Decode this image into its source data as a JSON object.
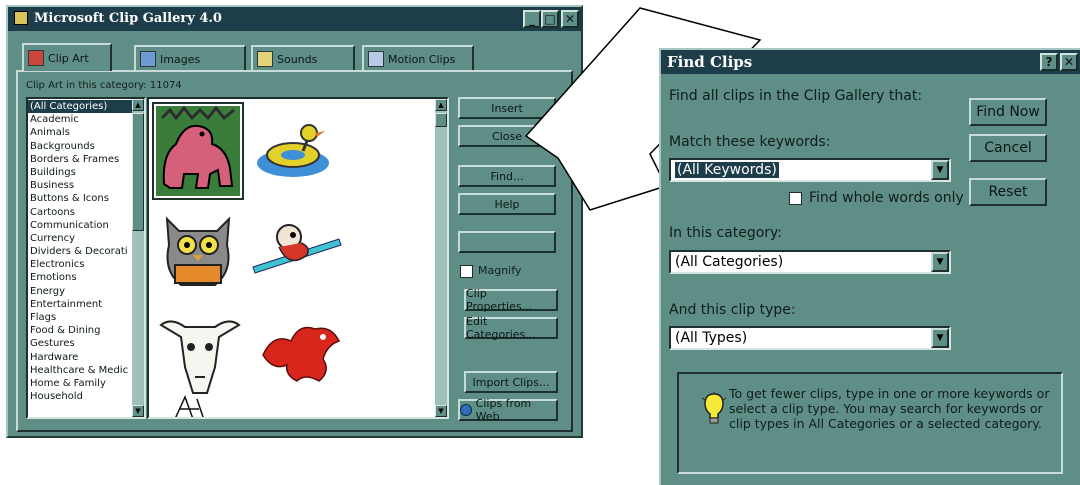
{
  "clip_gallery": {
    "title": "Microsoft Clip Gallery 4.0",
    "window_controls": [
      "_",
      "□",
      "✕"
    ],
    "tabs": [
      {
        "label": "Clip Art"
      },
      {
        "label": "Images"
      },
      {
        "label": "Sounds"
      },
      {
        "label": "Motion Clips"
      }
    ],
    "category_caption": "Clip Art in this category: 11074",
    "categories": [
      "(All Categories)",
      "Academic",
      "Animals",
      "Backgrounds",
      "Borders & Frames",
      "Buildings",
      "Business",
      "Buttons & Icons",
      "Cartoons",
      "Communication",
      "Currency",
      "Dividers & Decorati",
      "Electronics",
      "Emotions",
      "Energy",
      "Entertainment",
      "Flags",
      "Food & Dining",
      "Gestures",
      "Hardware",
      "Healthcare & Medic",
      "Home & Family",
      "Household"
    ],
    "buttons": {
      "insert": "Insert",
      "close": "Close",
      "find": "Find...",
      "help": "Help",
      "blank": "",
      "clip_properties": "Clip Properties...",
      "edit_categories": "Edit Categories...",
      "import_clips": "Import Clips...",
      "clips_from_web": "Clips from Web"
    },
    "magnify_label": "Magnify",
    "clip_icons": [
      "dinosaur-clip",
      "duck-float-clip",
      "owl-reading-clip",
      "diver-clip",
      "bull-skull-clip",
      "dragon-clip",
      "small-figure-clip"
    ]
  },
  "find_clips": {
    "title": "Find Clips",
    "help_btn": "?",
    "close_btn": "✕",
    "intro": "Find all clips in the Clip Gallery that:",
    "keywords_label": "Match these keywords:",
    "keywords_value": "(All Keywords)",
    "whole_words_label": "Find whole words only",
    "category_label": "In this category:",
    "category_value": "(All Categories)",
    "type_label": "And this clip type:",
    "type_value": "(All Types)",
    "find_now": "Find Now",
    "cancel": "Cancel",
    "reset": "Reset",
    "tip": "To get fewer clips, type in one or more keywords or select a clip type.  You may search for keywords or clip types in All Categories or a selected category.",
    "tip_icon": "lightbulb-icon"
  },
  "colors": {
    "dialog_bg": "#5f8e87",
    "titlebar_bg": "#1e3d4a",
    "selection_bg": "#1e3d4a"
  }
}
